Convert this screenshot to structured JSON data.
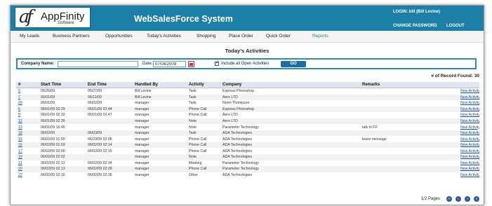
{
  "brand": {
    "mark": "af",
    "name": "AppFinity",
    "sub": "Software"
  },
  "header": {
    "system_title": "WebSalesForce System",
    "login": "LOGIN: bill (Bill Levine)",
    "change_password": "CHANGE PASSWORD",
    "logout": "LOGOUT"
  },
  "nav": {
    "items": [
      {
        "label": "My Leads"
      },
      {
        "label": "Business Partners"
      },
      {
        "label": "Opportunities"
      },
      {
        "label": "Today's Activities"
      },
      {
        "label": "Shopping"
      },
      {
        "label": "Place Order"
      },
      {
        "label": "Quick Order"
      },
      {
        "label": "Reports"
      }
    ],
    "active": "Reports"
  },
  "page": {
    "title": "Today's Activities"
  },
  "filter": {
    "company_label": "Company Name:",
    "company_value": "",
    "date_label": "Date:",
    "date_value": "07/04/2009",
    "include_label": "Include all Open Activities",
    "include_checked": "✓",
    "go_label": "GO"
  },
  "records_found": "# of Record Found: 30",
  "table": {
    "headers": [
      "#",
      "Start Time",
      "End Time",
      "Handled By",
      "Activity",
      "Company",
      "Remarks",
      ""
    ],
    "rows": [
      [
        "5",
        "05/26/09",
        "05/27/09",
        "Bill Levine",
        "Task",
        "Express Photoshop",
        "",
        "New Activity"
      ],
      [
        "7",
        "06/01/09",
        "06/11/09",
        "Bill Levine",
        "Task",
        "Aero LTD",
        "",
        "New Activity"
      ],
      [
        "20",
        "06/01/09",
        "06/02/09",
        "manager",
        "Task",
        "Norm Thompson",
        "",
        "New Activity"
      ],
      [
        "6",
        "06/01/09 02:29",
        "06/01/09 02:44",
        "manager",
        "Phone Call",
        "Express Photoshop",
        "",
        "New Activity"
      ],
      [
        "8",
        "06/01/09 02:32",
        "06/01/09 02:47",
        "manager",
        "Phone Call",
        "Aero LTD",
        "",
        "New Activity"
      ],
      [
        "12",
        "06/01/09 02:35",
        "",
        "manager",
        "Note",
        "Aero LTD",
        "",
        "New Activity"
      ],
      [
        "13",
        "06/01/09 16:45",
        "",
        "manager",
        "Note",
        "Parameter Technology",
        "talk to FF",
        "New Activity"
      ],
      [
        "18",
        "06/02/09",
        "06/03/09",
        "manager",
        "Task",
        "ADA Technologies",
        "",
        "New Activity"
      ],
      [
        "15",
        "06/02/09 01:50",
        "06/23/09 02:05",
        "manager",
        "Phone Call",
        "ADA Technologies",
        "leave message",
        "New Activity"
      ],
      [
        "16",
        "06/02/09 01:59",
        "06/02/09 02:14",
        "manager",
        "Phone Call",
        "ADA Technologies",
        "",
        "New Activity"
      ],
      [
        "17",
        "06/02/09 02:00",
        "06/02/09 02:15",
        "manager",
        "Phone Call",
        "ADA Technologies",
        "",
        "New Activity"
      ],
      [
        "19",
        "06/02/09 02:02",
        "",
        "manager",
        "Note",
        "ADA Technologies",
        "",
        "New Activity"
      ],
      [
        "21",
        "06/02/09 02:12",
        "06/02/09 02:34",
        "manager",
        "Meeting",
        "Parameter Technology",
        "",
        "New Activity"
      ],
      [
        "20",
        "06/02/09 02:13",
        "06/02/09 02:28",
        "manager",
        "Phone Call",
        "Parameter Technology",
        "",
        "New Activity"
      ],
      [
        "22",
        "06/02/09 02:16",
        "06/02/09 02:36",
        "manager",
        "Other",
        "ADA Technologies",
        "",
        "New Activity"
      ]
    ]
  },
  "pager": {
    "text": "1/2 Pages",
    "buttons": [
      "«",
      "‹",
      "›",
      "»"
    ]
  }
}
